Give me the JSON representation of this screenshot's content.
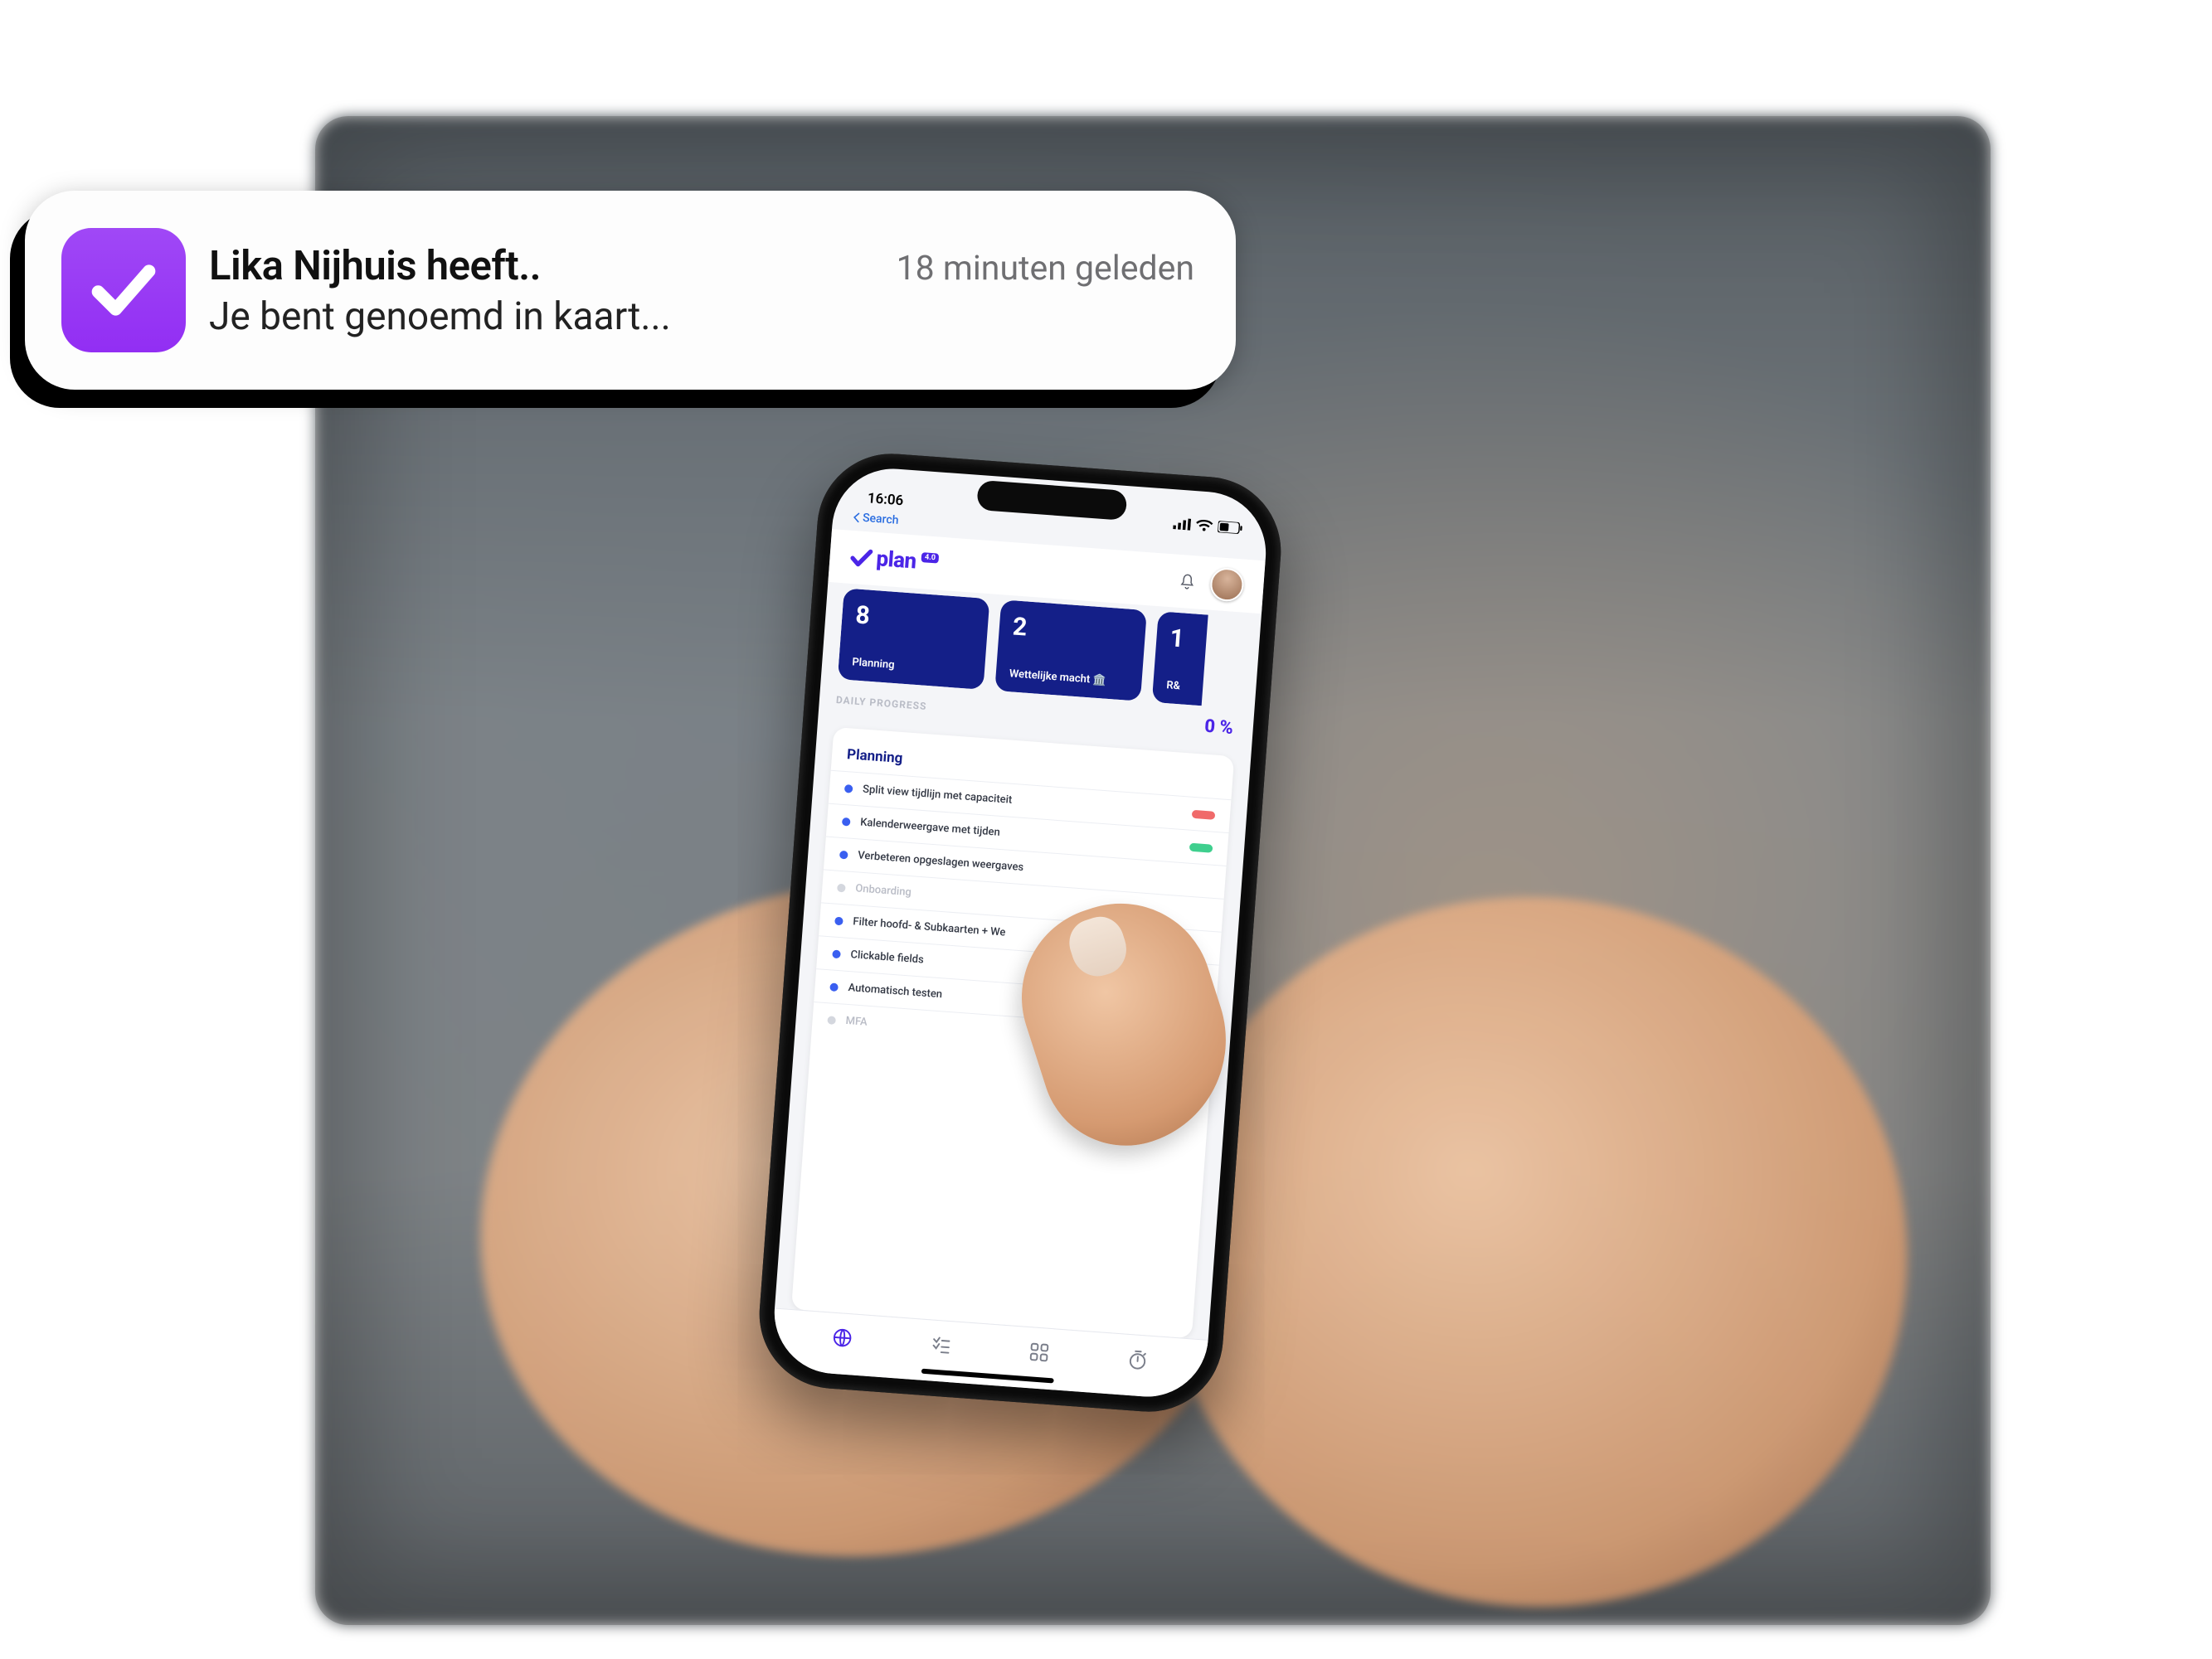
{
  "notification": {
    "title": "Lika Nijhuis heeft..",
    "time": "18 minuten geleden",
    "body": "Je bent genoemd in kaart..."
  },
  "phone": {
    "status": {
      "time": "16:06",
      "back_label": "Search"
    },
    "logo_text": "plan",
    "logo_badge": "4.0",
    "tiles": [
      {
        "value": "8",
        "label": "Planning"
      },
      {
        "value": "2",
        "label": "Wettelijke macht 🏛️"
      },
      {
        "value": "1",
        "label": "R&"
      }
    ],
    "progress": {
      "label": "DAILY PROGRESS",
      "value": "0 %"
    },
    "card": {
      "title": "Planning",
      "items": [
        {
          "text": "Split view tijdlijn met capaciteit",
          "dot": "blue",
          "pill": "red"
        },
        {
          "text": "Kalenderweergave met tijden",
          "dot": "blue",
          "pill": "green"
        },
        {
          "text": "Verbeteren opgeslagen weergaves",
          "dot": "blue",
          "pill": null
        },
        {
          "text": "Onboarding",
          "dot": "gray",
          "pill": null,
          "faded": true
        },
        {
          "text": "Filter hoofd- & Subkaarten + We",
          "dot": "blue",
          "pill": null
        },
        {
          "text": "Clickable fields",
          "dot": "blue",
          "pill": null
        },
        {
          "text": "Automatisch testen",
          "dot": "blue",
          "pill": null
        },
        {
          "text": "MFA",
          "dot": "gray",
          "pill": null,
          "faded": true
        }
      ]
    }
  },
  "colors": {
    "brand_purple": "#922ef3",
    "brand_indigo": "#4b25e7",
    "tile_navy": "#141f88",
    "pill_red": "#f06a6a",
    "pill_green": "#3fcf8e"
  }
}
